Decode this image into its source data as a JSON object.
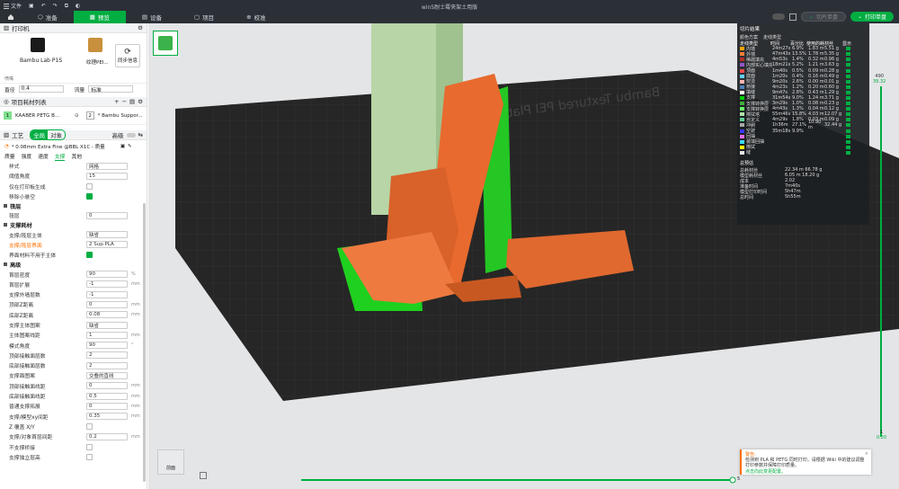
{
  "window": {
    "title": "win5耐士霉夹架土用版"
  },
  "menu": {
    "file_label": "文件"
  },
  "tabs": [
    {
      "label": "准备"
    },
    {
      "label": "预览"
    },
    {
      "label": "设备"
    },
    {
      "label": "项目"
    },
    {
      "label": "校准"
    }
  ],
  "actions": {
    "slice_label": "切片单盘",
    "print_label": "打印单盘"
  },
  "printer": {
    "section_label": "打印机",
    "name": "Bambu Lab P1S",
    "plate": "纹理PEI...",
    "sync_label": "同步信息",
    "sub_label": "喷嘴",
    "nozzle_label": "直径",
    "nozzle_value": "0.4",
    "flow_label": "流量",
    "flow_value": "标准"
  },
  "filaments": {
    "section_label": "项目耗材列表",
    "items": [
      {
        "index": "1",
        "name": "KAABER PETG B..."
      },
      {
        "index": "2",
        "name": "* Bambu Suppor..."
      }
    ]
  },
  "process": {
    "section_label": "工艺",
    "global_label": "全局",
    "object_label": "对象",
    "advanced_label": "高级",
    "preset": "* 0.08mm Extra Fine @BBL X1C - 质量",
    "subtabs": [
      "质量",
      "强度",
      "速度",
      "支撑",
      "其他"
    ],
    "active_subtab": 3
  },
  "settings": {
    "top_rows": [
      {
        "label": "样式",
        "value": "网格"
      },
      {
        "label": "阈值角度",
        "value": "15"
      },
      {
        "label": "仅在打印板生成",
        "check": false
      },
      {
        "label": "移除小悬空",
        "check": true
      }
    ],
    "raft": {
      "title": "筏层",
      "rows": [
        {
          "label": "筏层",
          "value": "0"
        }
      ]
    },
    "filament": {
      "title": "支撑耗材",
      "rows": [
        {
          "label": "支撑/筏层主体",
          "value": "缺省"
        },
        {
          "label": "支撑/筏层界面",
          "value": "2 Sup.PLA"
        },
        {
          "label": "界面材料不用于主体",
          "check": true
        }
      ]
    },
    "advanced": {
      "title": "高级",
      "rows": [
        {
          "label": "首层密度",
          "value": "90",
          "unit": "%"
        },
        {
          "label": "首层扩展",
          "value": "-1",
          "unit": "mm"
        },
        {
          "label": "支撑外墙层数",
          "value": "-1"
        },
        {
          "label": "顶部Z距离",
          "value": "0",
          "unit": "mm"
        },
        {
          "label": "底部Z距离",
          "value": "0.08",
          "unit": "mm"
        },
        {
          "label": "支撑主体图案",
          "value": "缺省"
        },
        {
          "label": "主体图案线距",
          "value": "1",
          "unit": "mm"
        },
        {
          "label": "模式角度",
          "value": "90",
          "unit": "°"
        },
        {
          "label": "顶部接触面层数",
          "value": "2"
        },
        {
          "label": "底部接触面层数",
          "value": "2"
        },
        {
          "label": "支撑面图案",
          "value": "交叠的直线"
        },
        {
          "label": "顶部接触面线距",
          "value": "0",
          "unit": "mm"
        },
        {
          "label": "底部接触面线距",
          "value": "0.5",
          "unit": "mm"
        },
        {
          "label": "普通支撑拓展",
          "value": "0",
          "unit": "mm"
        },
        {
          "label": "支撑/模型xy间距",
          "value": "0.35",
          "unit": "mm"
        },
        {
          "label": "Z 覆盖 X/Y",
          "check": false
        },
        {
          "label": "支撑/对象首层间距",
          "value": "0.2",
          "unit": "mm"
        },
        {
          "label": "不支撑桥接",
          "check": false
        },
        {
          "label": "支撑独立层高",
          "check": false
        }
      ]
    }
  },
  "slice_panel": {
    "title": "切片结果",
    "mode_label": "颜色方案",
    "mode_value": "走线类型",
    "headers": [
      "走线类型",
      "时间",
      "百分比",
      "使用的耗材丝",
      "显示"
    ],
    "rows": [
      {
        "name": "内墙",
        "time": "24m27s",
        "pct": "6.9%",
        "len": "1.83 m",
        "wt": "5.51 g",
        "color": "#ffa500"
      },
      {
        "name": "外墙",
        "time": "47m43s",
        "pct": "13.5%",
        "len": "1.78 m",
        "wt": "5.35 g",
        "color": "#ff7d38"
      },
      {
        "name": "稀疏填充",
        "time": "4m53s",
        "pct": "1.4%",
        "len": "0.32 m",
        "wt": "0.96 g",
        "color": "#b03029"
      },
      {
        "name": "内部实心填充",
        "time": "18m21s",
        "pct": "5.2%",
        "len": "1.21 m",
        "wt": "3.63 g",
        "color": "#9654cc"
      },
      {
        "name": "顶面",
        "time": "1m40s",
        "pct": "0.5%",
        "len": "0.09 m",
        "wt": "0.28 g",
        "color": "#f04848"
      },
      {
        "name": "底面",
        "time": "1m20s",
        "pct": "0.4%",
        "len": "0.16 m",
        "wt": "0.49 g",
        "color": "#66ccf2"
      },
      {
        "name": "熨烫",
        "time": "9m20s",
        "pct": "2.6%",
        "len": "0.00 m",
        "wt": "0.01 g",
        "color": "#ffb3b3"
      },
      {
        "name": "桥接",
        "time": "4m23s",
        "pct": "1.2%",
        "len": "0.20 m",
        "wt": "0.60 g",
        "color": "#4d80ba"
      },
      {
        "name": "填缝",
        "time": "9m47s",
        "pct": "2.8%",
        "len": "0.43 m",
        "wt": "1.29 g",
        "color": "#fafafa"
      },
      {
        "name": "支撑",
        "time": "31m54s",
        "pct": "9.0%",
        "len": "1.24 m",
        "wt": "3.71 g",
        "color": "#00cc00"
      },
      {
        "name": "支撑转换层",
        "time": "3m29s",
        "pct": "1.0%",
        "len": "0.08 m",
        "wt": "0.23 g",
        "color": "#40ad40"
      },
      {
        "name": "支撑转换层",
        "time": "4m43s",
        "pct": "1.3%",
        "len": "0.04 m",
        "wt": "0.12 g",
        "color": "#66ff66"
      },
      {
        "name": "擦拭塔",
        "time": "55m46s",
        "pct": "15.8%",
        "len": "4.03 m",
        "wt": "12.07 g",
        "color": "#b3e3ab"
      },
      {
        "name": "自定义",
        "time": "4m29s",
        "pct": "1.8%",
        "len": "0.03 m",
        "wt": "0.09 g",
        "color": "#5ed194"
      },
      {
        "name": "冲刷",
        "time": "1h36m",
        "pct": "27.1%",
        "len": "10.90 m",
        "wt": "32.44 g",
        "color": "#a9a9a9"
      },
      {
        "name": "空驶",
        "time": "35m18s",
        "pct": "9.9%",
        "len": "",
        "wt": "",
        "color": "#3838ff"
      },
      {
        "name": "回抽",
        "time": "",
        "pct": "",
        "len": "",
        "wt": "",
        "color": "#e36cf2"
      },
      {
        "name": "装填回抽",
        "time": "",
        "pct": "",
        "len": "",
        "wt": "",
        "color": "#38d9ff"
      },
      {
        "name": "擦拭",
        "time": "",
        "pct": "",
        "len": "",
        "wt": "",
        "color": "#ffff00"
      },
      {
        "name": "缝",
        "time": "",
        "pct": "",
        "len": "",
        "wt": "",
        "color": "#e6e6e6"
      }
    ],
    "summary_title": "总预估",
    "summary": [
      {
        "label": "总耗材丝",
        "value": "22.34 m   66.78 g"
      },
      {
        "label": "模型耗材丝",
        "value": "6.05 m   18.20 g"
      },
      {
        "label": "成本",
        "value": "2.02"
      },
      {
        "label": "准备时间",
        "value": "7m40s"
      },
      {
        "label": "模型打印时间",
        "value": "5h47m"
      },
      {
        "label": "总时间",
        "value": "5h55m"
      }
    ]
  },
  "layers": {
    "top_value": "490",
    "top_height": "39.32",
    "bottom_value": "1",
    "bottom_height": "0.20",
    "h_end": "5"
  },
  "bed": {
    "brand": "Bambu Textured PEI Plate"
  },
  "cube": {
    "label": "前面"
  },
  "warning": {
    "title": "警告:",
    "text": "检测到 PLA 和 PETG 同时打印，请根据 Wiki 中的建议调整打印参数并保障打印质量。",
    "link": "点击向此变更配置。"
  }
}
